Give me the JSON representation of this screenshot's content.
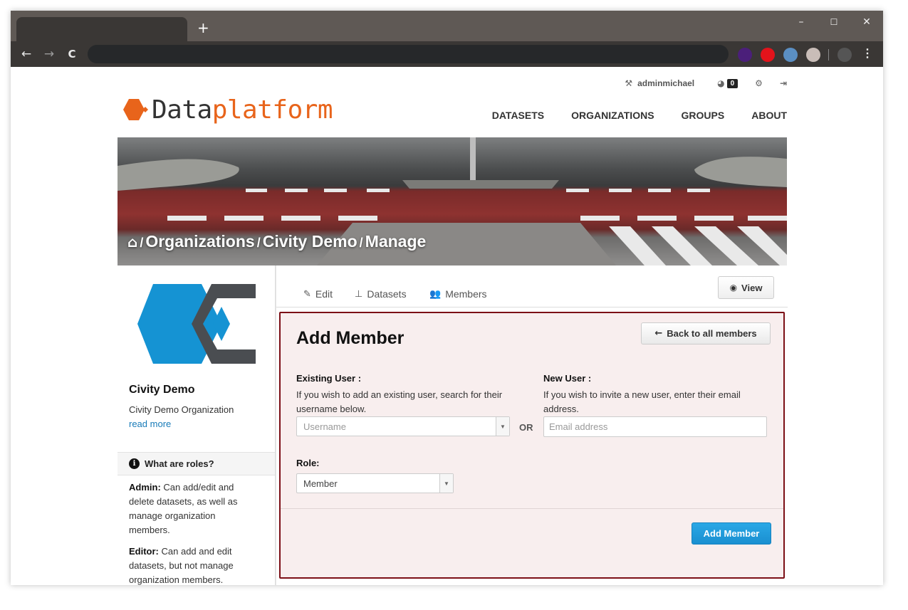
{
  "browser": {
    "new_tab": "+",
    "min": "–",
    "max": "☐",
    "close": "✕",
    "back": "←",
    "forward": "→",
    "reload": "C",
    "menu": "⋮",
    "extension_colors": [
      "#4b1f7a",
      "#e3131b",
      "#5b8fc3",
      "#c9bdb8",
      "#555555"
    ]
  },
  "user_nav": {
    "username": "adminmichael",
    "notification_count": "0"
  },
  "logo": {
    "part1": "Data",
    "part2": "platform",
    "accent_color": "#e8641b"
  },
  "main_nav": [
    "DATASETS",
    "ORGANIZATIONS",
    "GROUPS",
    "ABOUT"
  ],
  "breadcrumb": {
    "items": [
      "Organizations",
      "Civity Demo",
      "Manage"
    ],
    "separator": "/"
  },
  "sidebar": {
    "org_title": "Civity Demo",
    "org_description": "Civity Demo Organization",
    "read_more": "read more",
    "roles_heading": "What are roles?",
    "roles": [
      {
        "name": "Admin:",
        "text": " Can add/edit and delete datasets, as well as manage organization members."
      },
      {
        "name": "Editor:",
        "text": " Can add and edit datasets, but not manage organization members."
      }
    ]
  },
  "tabs": {
    "edit": "Edit",
    "datasets": "Datasets",
    "members": "Members",
    "view": "View"
  },
  "form": {
    "title": "Add Member",
    "back_button": "Back to all members",
    "existing_label": "Existing User :",
    "existing_help": "If you wish to add an existing user, search for their username below.",
    "username_placeholder": "Username",
    "or": "OR",
    "new_label": "New User :",
    "new_help": "If you wish to invite a new user, enter their email address.",
    "email_placeholder": "Email address",
    "role_label": "Role:",
    "role_value": "Member",
    "submit": "Add Member"
  }
}
